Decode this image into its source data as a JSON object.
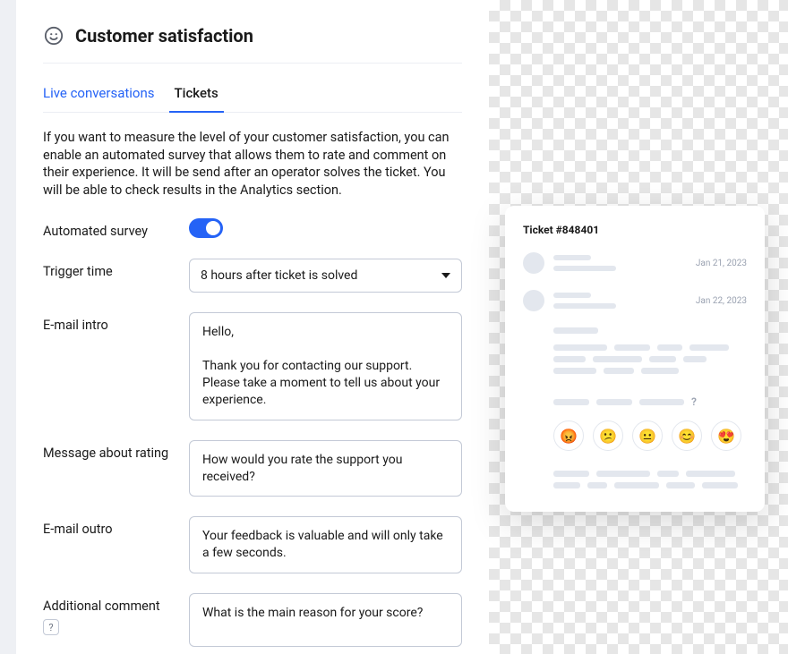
{
  "header": {
    "title": "Customer satisfaction"
  },
  "tabs": {
    "live": "Live conversations",
    "tickets": "Tickets"
  },
  "intro": "If you want to measure the level of your customer satisfaction, you can enable an automated survey that allows them to rate and comment on their experience. It will be send after an operator solves the ticket. You will be able to check results in the Analytics section.",
  "form": {
    "automated_survey": {
      "label": "Automated survey",
      "enabled": true
    },
    "trigger_time": {
      "label": "Trigger time",
      "value": "8 hours after ticket is solved"
    },
    "email_intro": {
      "label": "E-mail intro",
      "value": "Hello,\n\nThank you for contacting our support. Please take a moment to tell us about your experience."
    },
    "rating_message": {
      "label": "Message about rating",
      "value": "How would you rate the support you received?"
    },
    "email_outro": {
      "label": "E-mail outro",
      "value": "Your feedback is valuable and will only take a few seconds."
    },
    "additional_comment": {
      "label": "Additional comment",
      "help": "?",
      "value": "What is the main reason for your score?"
    }
  },
  "preview": {
    "ticket_label": "Ticket #848401",
    "date1": "Jan 21, 2023",
    "date2": "Jan 22, 2023",
    "question_mark": "?",
    "emojis": [
      "😡",
      "😕",
      "😐",
      "😊",
      "😍"
    ]
  }
}
